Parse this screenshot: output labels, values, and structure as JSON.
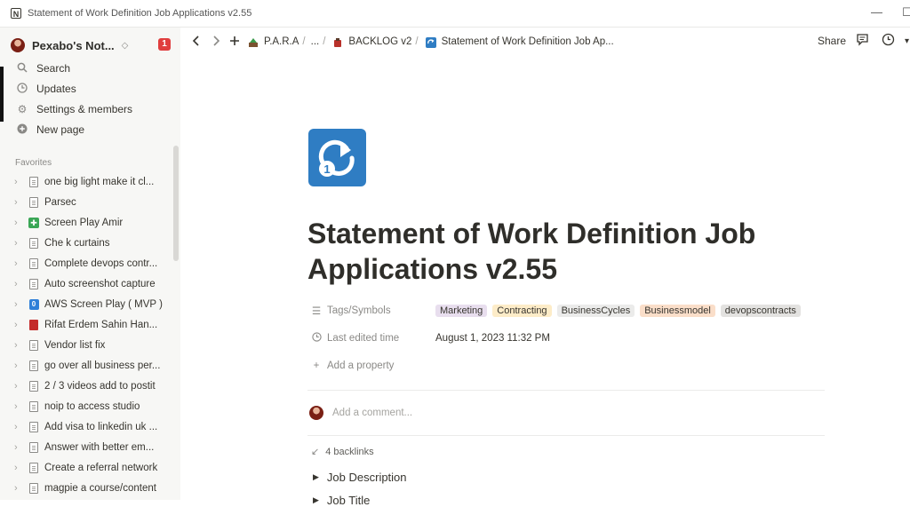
{
  "window": {
    "title": "Statement of Work Definition Job Applications v2.55",
    "minimize_glyph": "—",
    "maximize_glyph": "☐"
  },
  "sidebar": {
    "workspace_name": "Pexabo's Not...",
    "badge_count": "1",
    "nav": [
      {
        "label": "Search",
        "icon": "search-icon"
      },
      {
        "label": "Updates",
        "icon": "clock-icon"
      },
      {
        "label": "Settings & members",
        "icon": "gear-icon"
      },
      {
        "label": "New page",
        "icon": "plus-circle-icon"
      }
    ],
    "favorites_label": "Favorites",
    "favorites": [
      {
        "label": "one big light make it cl...",
        "icon": "doc"
      },
      {
        "label": "Parsec",
        "icon": "doc"
      },
      {
        "label": "Screen Play Amir",
        "icon": "green"
      },
      {
        "label": "Che k curtains",
        "icon": "doc"
      },
      {
        "label": "Complete devops contr...",
        "icon": "doc"
      },
      {
        "label": "Auto screenshot capture",
        "icon": "doc"
      },
      {
        "label": "AWS Screen Play ( MVP )",
        "icon": "blue"
      },
      {
        "label": "Rifat Erdem Sahin Han...",
        "icon": "red"
      },
      {
        "label": "Vendor list fix",
        "icon": "doc"
      },
      {
        "label": "go over all business per...",
        "icon": "doc"
      },
      {
        "label": "2 / 3 videos add to postit",
        "icon": "doc"
      },
      {
        "label": "noip to access studio",
        "icon": "doc"
      },
      {
        "label": "Add visa to linkedin uk ...",
        "icon": "doc"
      },
      {
        "label": "Answer with better em...",
        "icon": "doc"
      },
      {
        "label": "Create a referral network",
        "icon": "doc"
      },
      {
        "label": "magpie a course/content",
        "icon": "doc"
      }
    ]
  },
  "topbar": {
    "breadcrumbs": [
      "P.A.R.A",
      "...",
      "BACKLOG v2",
      "Statement of Work Definition Job Ap..."
    ],
    "share_label": "Share"
  },
  "page": {
    "title": "Statement of Work Definition Job Applications v2.55",
    "properties": {
      "tags_label": "Tags/Symbols",
      "tags": [
        {
          "label": "Marketing",
          "color": "#e8deee"
        },
        {
          "label": "Contracting",
          "color": "#fdecc8"
        },
        {
          "label": "BusinessCycles",
          "color": "#ebebea"
        },
        {
          "label": "Businessmodel",
          "color": "#fadec9"
        },
        {
          "label": "devopscontracts",
          "color": "#e3e2e0"
        }
      ],
      "edited_label": "Last edited time",
      "edited_value": "August 1, 2023 11:32 PM",
      "add_property": "Add a property"
    },
    "comment_placeholder": "Add a comment...",
    "backlinks": "4 backlinks",
    "toggles": [
      "Job Description",
      "Job Title"
    ]
  },
  "colors": {
    "sidebar_bg": "#f7f7f5",
    "icon_blue": "#2f7dc3",
    "badge_red": "#e03e3e",
    "text": "#37352f"
  }
}
